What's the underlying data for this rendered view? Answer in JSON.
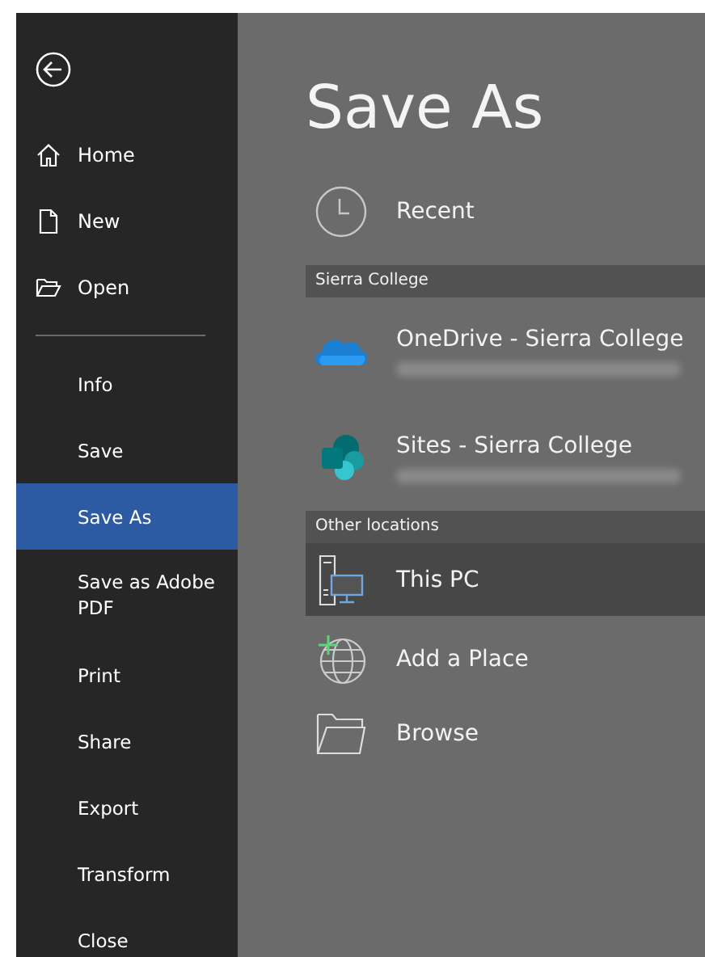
{
  "sidebar": {
    "top_items": [
      {
        "label": "Home"
      },
      {
        "label": "New"
      },
      {
        "label": "Open"
      }
    ],
    "items": [
      {
        "label": "Info",
        "selected": false
      },
      {
        "label": "Save",
        "selected": false
      },
      {
        "label": "Save As",
        "selected": true
      },
      {
        "label": "Save as Adobe PDF",
        "selected": false
      },
      {
        "label": "Print",
        "selected": false
      },
      {
        "label": "Share",
        "selected": false
      },
      {
        "label": "Export",
        "selected": false
      },
      {
        "label": "Transform",
        "selected": false
      },
      {
        "label": "Close",
        "selected": false
      }
    ]
  },
  "main": {
    "title": "Save As",
    "recent": {
      "label": "Recent"
    },
    "groups": [
      {
        "header": "Sierra College",
        "items": [
          {
            "kind": "onedrive",
            "label": "OneDrive - Sierra College",
            "selected": false,
            "redacted": true
          },
          {
            "kind": "sites",
            "label": "Sites - Sierra College",
            "selected": false,
            "redacted": true
          }
        ]
      },
      {
        "header": "Other locations",
        "items": [
          {
            "kind": "pc",
            "label": "This PC",
            "selected": true,
            "redacted": false
          },
          {
            "kind": "add",
            "label": "Add a Place",
            "selected": false,
            "redacted": false
          },
          {
            "kind": "browse",
            "label": "Browse",
            "selected": false,
            "redacted": false
          }
        ]
      }
    ]
  }
}
